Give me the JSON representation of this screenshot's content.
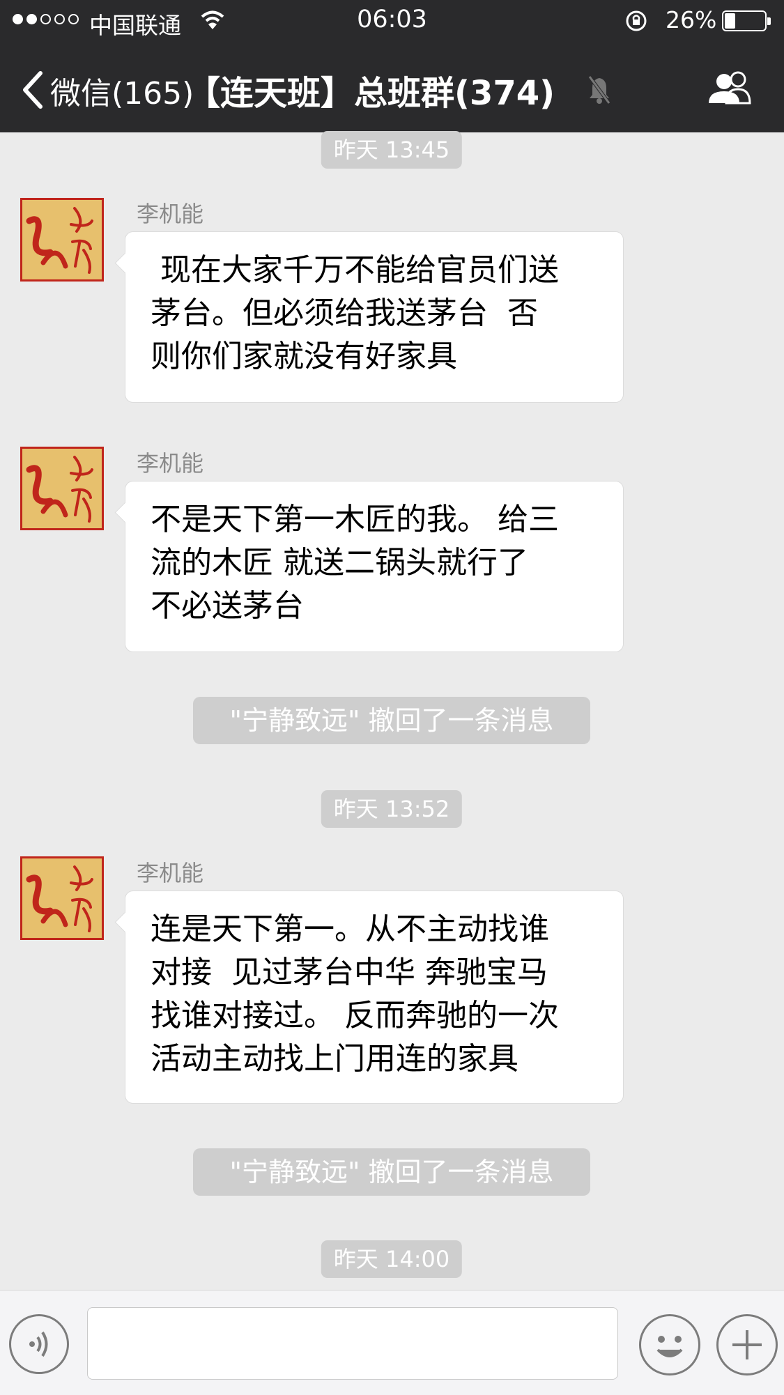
{
  "status_bar": {
    "carrier": "中国联通",
    "time": "06:03",
    "battery_percent": "26%",
    "battery_level": 0.26,
    "signal_bars": 2
  },
  "nav": {
    "back_label": "微信(165)",
    "title": "【连天班】总班群(374)",
    "icons": [
      "back-chevron-icon",
      "mute-bell-icon",
      "group-members-icon"
    ]
  },
  "chat": {
    "timestamps": [
      "昨天 13:45",
      "昨天 13:52",
      "昨天 14:00"
    ],
    "messages": [
      {
        "sender": "李机能",
        "avatar_text": "红连天",
        "lines": [
          " 现在大家千万不能给官员们送",
          "茅台。但必须给我送茅台  否",
          "则你们家就没有好家具"
        ]
      },
      {
        "sender": "李机能",
        "avatar_text": "红连天",
        "lines": [
          "不是天下第一木匠的我。 给三",
          "流的木匠 就送二锅头就行了",
          "不必送茅台"
        ]
      },
      {
        "sender": "李机能",
        "avatar_text": "红连天",
        "lines": [
          "连是天下第一。从不主动找谁",
          "对接  见过茅台中华 奔驰宝马",
          "找谁对接过。 反而奔驰的一次",
          "活动主动找上门用连的家具"
        ]
      }
    ],
    "recall_notices": [
      "\"宁静致远\" 撤回了一条消息",
      "\"宁静致远\" 撤回了一条消息"
    ]
  },
  "input_bar": {
    "icons": [
      "voice-icon",
      "emoji-icon",
      "plus-icon"
    ],
    "text_value": ""
  },
  "colors": {
    "header_bg": "#2a2a2c",
    "chat_bg": "#ebebeb",
    "pill_bg": "#cecece",
    "avatar_red": "#c0251b",
    "avatar_gold": "#e7c06d"
  }
}
